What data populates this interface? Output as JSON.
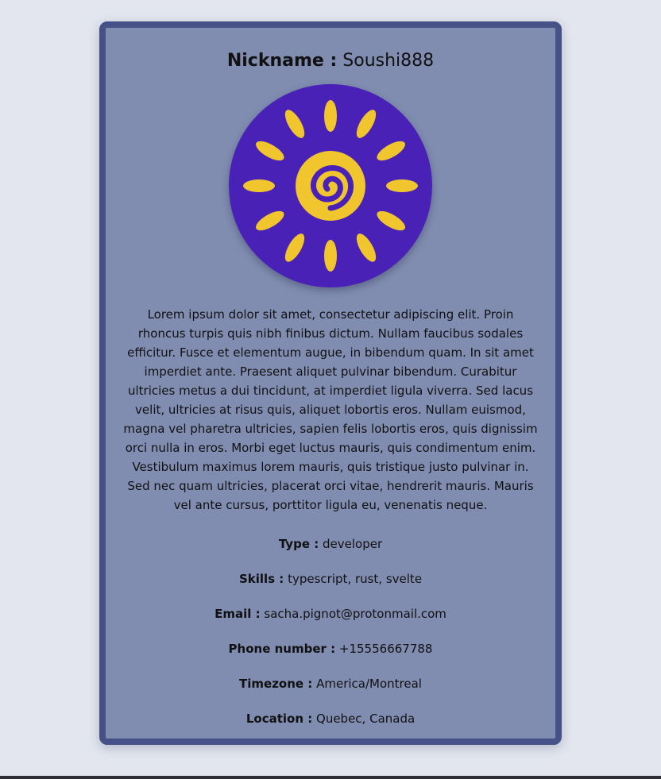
{
  "profile": {
    "nickname_label": "Nickname :",
    "nickname": "Soushi888",
    "bio": "Lorem ipsum dolor sit amet, consectetur adipiscing elit. Proin rhoncus turpis quis nibh finibus dictum. Nullam faucibus sodales efficitur. Fusce et elementum augue, in bibendum quam. In sit amet imperdiet ante. Praesent aliquet pulvinar bibendum. Curabitur ultricies metus a dui tincidunt, at imperdiet ligula viverra. Sed lacus velit, ultricies at risus quis, aliquet lobortis eros. Nullam euismod, magna vel pharetra ultricies, sapien felis lobortis eros, quis dignissim orci nulla in eros. Morbi eget luctus mauris, quis condimentum enim. Vestibulum maximus lorem mauris, quis tristique justo pulvinar in. Sed nec quam ultricies, placerat orci vitae, hendrerit mauris. Mauris vel ante cursus, porttitor ligula eu, venenatis neque.",
    "avatar_icon": "sun-logo-icon",
    "fields": [
      {
        "label": "Type :",
        "value": "developer"
      },
      {
        "label": "Skills :",
        "value": "typescript, rust, svelte"
      },
      {
        "label": "Email :",
        "value": "sacha.pignot@protonmail.com"
      },
      {
        "label": "Phone number :",
        "value": "+15556667788"
      },
      {
        "label": "Timezone :",
        "value": "America/Montreal"
      },
      {
        "label": "Location :",
        "value": "Quebec, Canada"
      }
    ]
  },
  "colors": {
    "page_background": "#e3e6ef",
    "card_background": "#808db1",
    "card_border": "#465287",
    "avatar_background": "#4a21b6",
    "sun_yellow": "#f0c52e"
  }
}
